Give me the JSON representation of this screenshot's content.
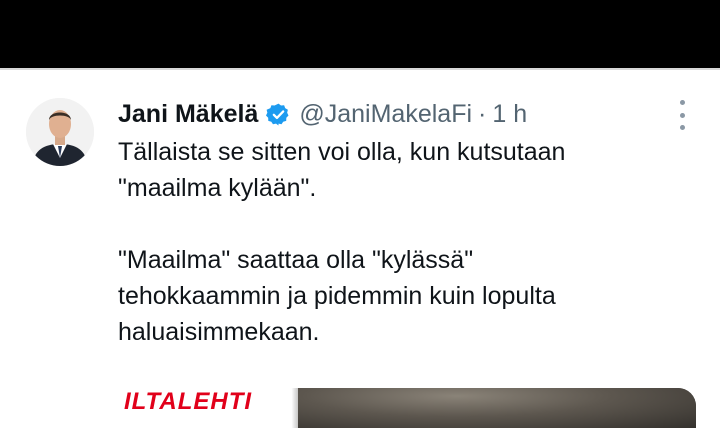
{
  "tweet": {
    "author_name": "Jani Mäkelä",
    "handle": "@JaniMakelaFi",
    "separator": "·",
    "time": "1 h",
    "verified_color": "#1d9bf0",
    "lines_para1": [
      "Tällaista se sitten voi olla, kun kutsutaan",
      "\"maailma kylään\"."
    ],
    "lines_para2": [
      "\"Maailma\" saattaa olla \"kylässä\"",
      "tehokkaammin ja pidemmin kuin lopulta",
      "haluaisimmekaan."
    ],
    "media_logo_text": "ILTALEHTI",
    "media_logo_color": "#e1001a"
  }
}
